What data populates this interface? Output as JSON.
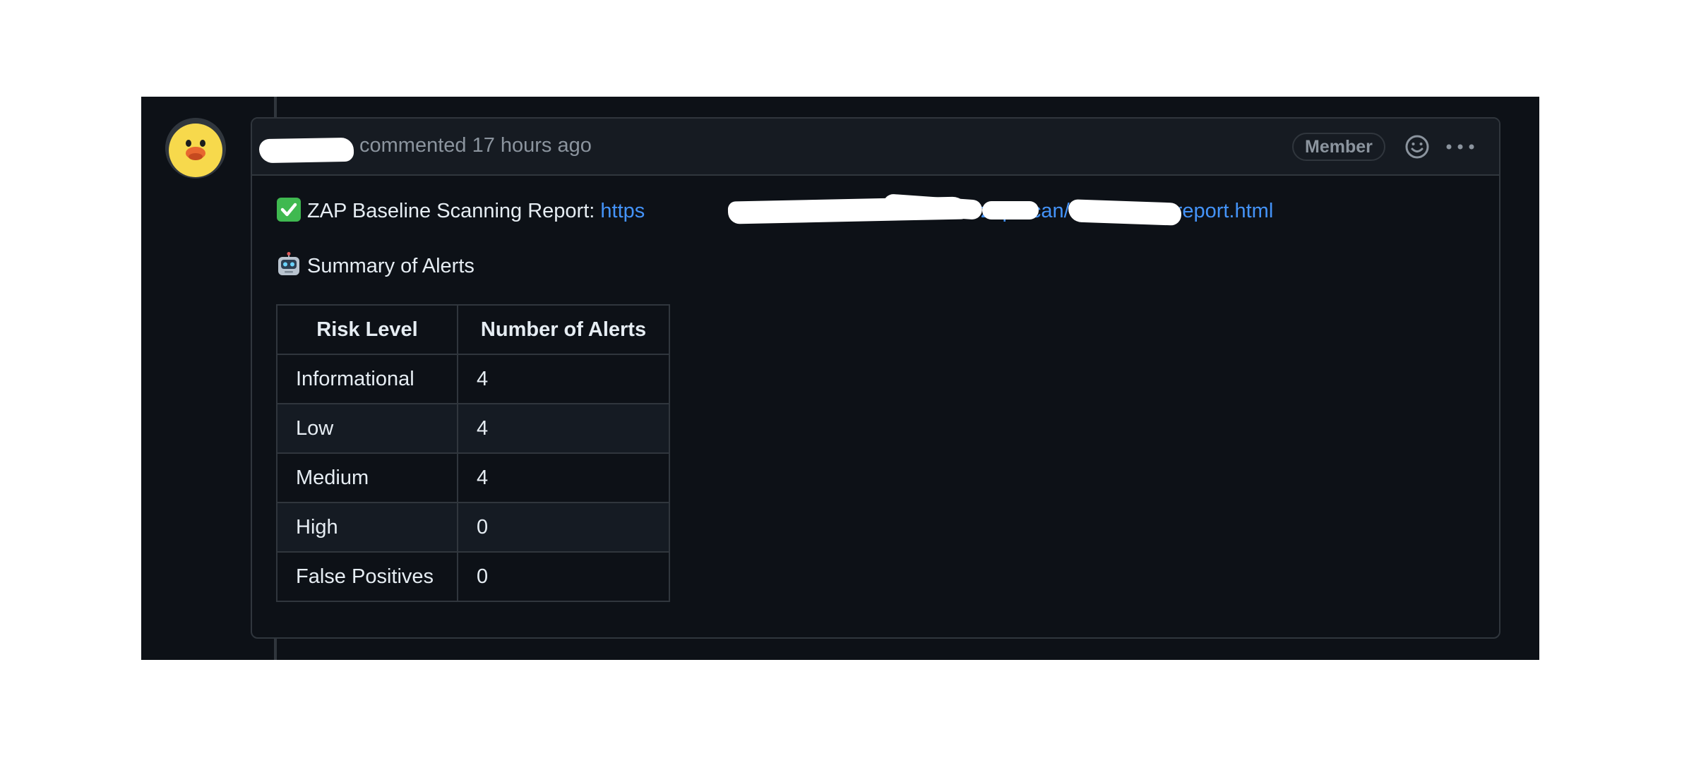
{
  "comment": {
    "action_text": "commented 17 hours ago",
    "badge": "Member",
    "icons": {
      "avatar": "duck-avatar-icon",
      "reaction": "smiley-icon",
      "menu": "kebab-menu-icon"
    }
  },
  "body": {
    "report_label": "ZAP Baseline Scanning Report:",
    "report_link_start": "https",
    "report_link_mid": "-zap-scan/",
    "report_link_end": "report.html",
    "summary_label": "Summary of Alerts",
    "icons": {
      "report": "check-mark-icon",
      "summary": "robot-icon"
    }
  },
  "table": {
    "headers": [
      "Risk Level",
      "Number of Alerts"
    ],
    "rows": [
      {
        "risk": "Informational",
        "count": "4"
      },
      {
        "risk": "Low",
        "count": "4"
      },
      {
        "risk": "Medium",
        "count": "4"
      },
      {
        "risk": "High",
        "count": "0"
      },
      {
        "risk": "False Positives",
        "count": "0"
      }
    ]
  },
  "colors": {
    "background": "#0d1117",
    "header_bg": "#161b22",
    "border": "#30363d",
    "text": "#e6edf3",
    "muted": "#8b949e",
    "link": "#4493f8",
    "check_green": "#3fb950"
  }
}
